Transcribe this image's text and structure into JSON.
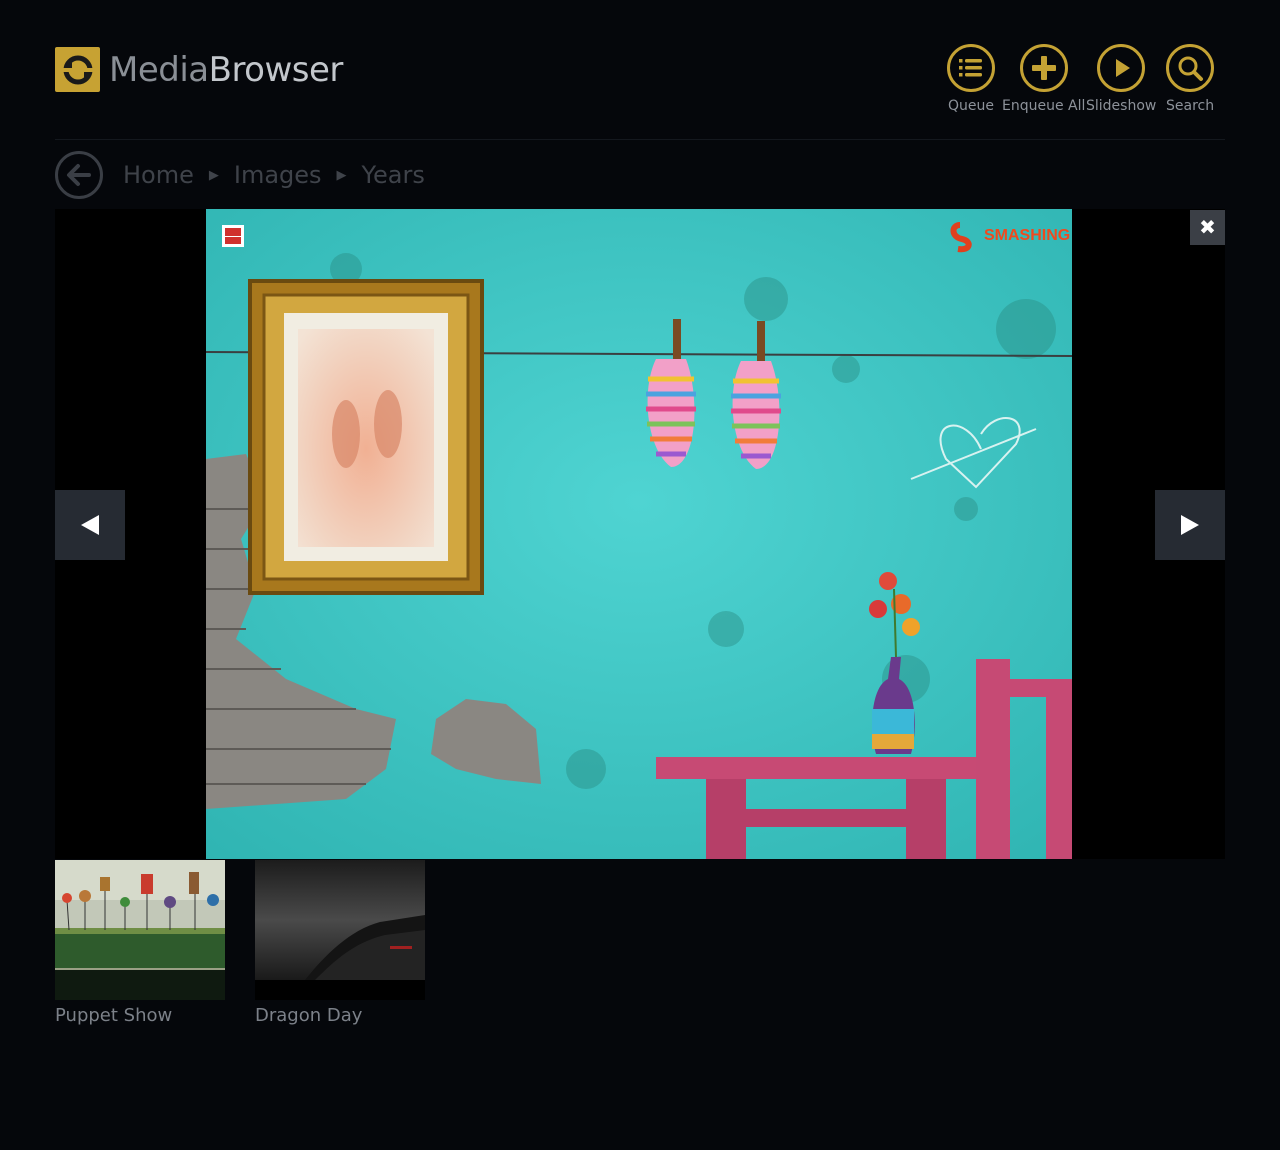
{
  "app": {
    "name_light": "Media",
    "name_bold": "Browser",
    "brand_color": "#c7a233"
  },
  "toolbar": {
    "queue": {
      "label": "Queue",
      "icon": "numbered-list-icon"
    },
    "enqueue_all": {
      "label": "Enqueue All",
      "icon": "plus-icon"
    },
    "slideshow": {
      "label": "Slideshow",
      "icon": "play-icon"
    },
    "search": {
      "label": "Search",
      "icon": "search-icon"
    }
  },
  "breadcrumb": {
    "back_icon": "back-arrow-icon",
    "items": [
      "Home",
      "Images",
      "Years"
    ]
  },
  "viewer": {
    "close_glyph": "✖",
    "prev_icon": "previous-arrow-icon",
    "next_icon": "next-arrow-icon",
    "image_brand": "SMASHING"
  },
  "thumbnails": [
    {
      "title": "Puppet Show"
    },
    {
      "title": "Dragon Day"
    }
  ]
}
